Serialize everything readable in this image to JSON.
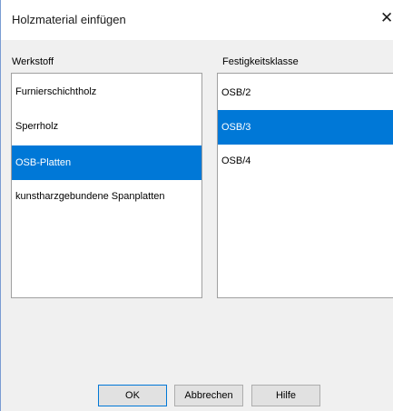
{
  "window": {
    "title": "Holzmaterial einfügen",
    "close_glyph": "✕"
  },
  "material": {
    "header": "Werkstoff",
    "items": [
      "Furnierschichtholz",
      "Sperrholz",
      "OSB-Platten",
      "kunstharzgebundene Spanplatten"
    ],
    "selected": "OSB-Platten"
  },
  "strength": {
    "header": "Festigkeitsklasse",
    "items": [
      "OSB/2",
      "OSB/3",
      "OSB/4"
    ],
    "selected": "OSB/3"
  },
  "buttons": {
    "ok": "OK",
    "cancel": "Abbrechen",
    "help": "Hilfe"
  },
  "colors": {
    "selection": "#0078d7",
    "window_border": "#7a9cd3"
  }
}
